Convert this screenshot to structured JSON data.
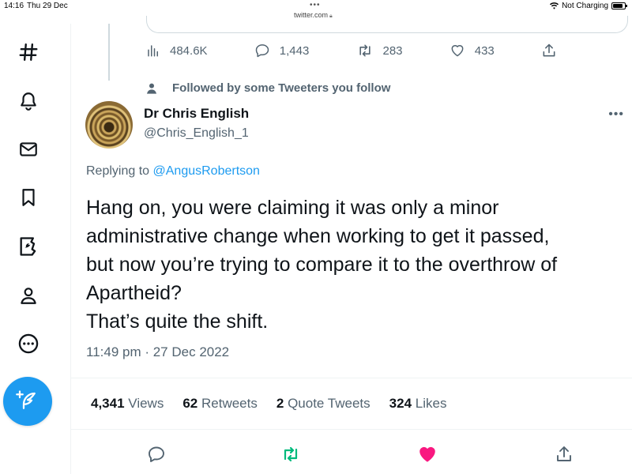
{
  "status_bar": {
    "time": "14:16",
    "date": "Thu 29 Dec",
    "url": "twitter.com",
    "charging": "Not Charging"
  },
  "sidebar": {
    "items": [
      {
        "icon": "hashtag-icon",
        "label": "Explore"
      },
      {
        "icon": "bell-icon",
        "label": "Notifications"
      },
      {
        "icon": "mail-icon",
        "label": "Messages"
      },
      {
        "icon": "bookmark-icon",
        "label": "Bookmarks"
      },
      {
        "icon": "twitter-blue-icon",
        "label": "Twitter Blue"
      },
      {
        "icon": "profile-icon",
        "label": "Profile"
      },
      {
        "icon": "more-circle-icon",
        "label": "More"
      }
    ],
    "compose_icon": "feather-plus-icon"
  },
  "previous_tweet": {
    "views": "484.6K",
    "replies": "1,443",
    "retweets": "283",
    "likes": "433"
  },
  "social_context": "Followed by some Tweeters you follow",
  "tweet": {
    "author_name": "Dr Chris English",
    "author_handle": "@Chris_English_1",
    "replying_prefix": "Replying to",
    "replying_to": "@AngusRobertson",
    "text": "Hang on, you were claiming it was only a minor\nadministrative change when working to get it passed,\nbut now you’re trying to compare it to the overthrow of\nApartheid?\nThat’s quite the shift.",
    "timestamp": "11:49 pm · 27 Dec 2022",
    "stats": {
      "views_count": "4,341",
      "views_label": "Views",
      "retweets_count": "62",
      "retweets_label": "Retweets",
      "quotes_count": "2",
      "quotes_label": "Quote Tweets",
      "likes_count": "324",
      "likes_label": "Likes"
    }
  },
  "colors": {
    "accent": "#1d9bf0",
    "retweet_active": "#00ba7c",
    "like_active": "#f91880",
    "secondary_text": "#536471"
  }
}
